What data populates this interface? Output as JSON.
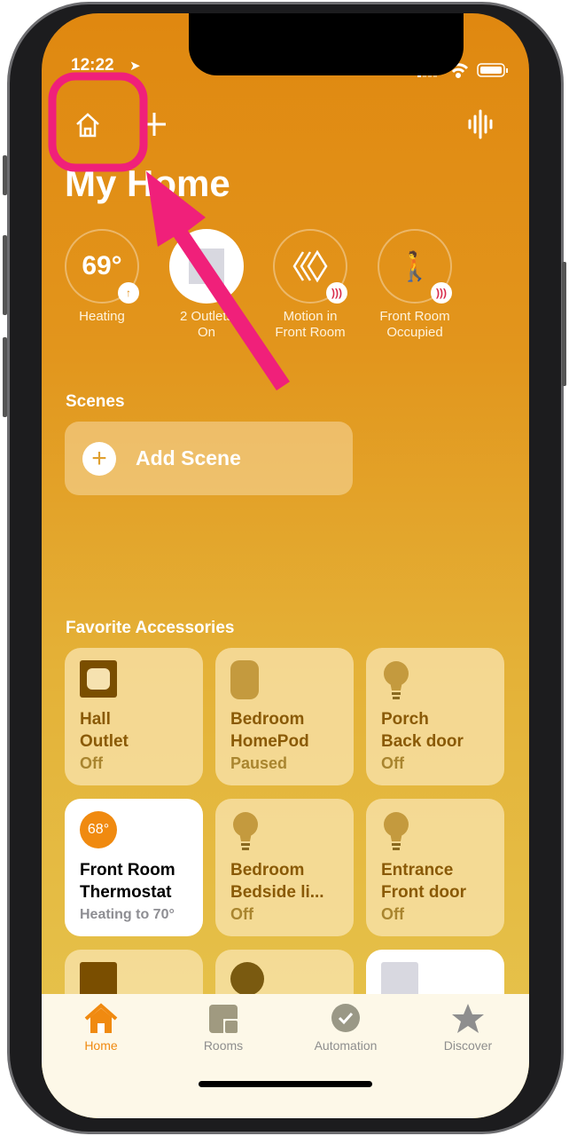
{
  "status_bar": {
    "time": "12:22"
  },
  "header": {
    "title": "My Home",
    "icons": [
      "home-icon",
      "plus-icon",
      "waveform-icon"
    ]
  },
  "status_items": [
    {
      "value": "69°",
      "line1": "Heating",
      "line2": "",
      "badge": "arrow-up"
    },
    {
      "value": "",
      "line1": "2 Outlets",
      "line2": "On",
      "badge": ""
    },
    {
      "value": "",
      "line1": "Motion in",
      "line2": "Front Room",
      "badge": "sound-waves"
    },
    {
      "value": "",
      "line1": "Front Room",
      "line2": "Occupied",
      "badge": "sound-waves"
    }
  ],
  "scenes": {
    "label": "Scenes",
    "add_label": "Add Scene"
  },
  "favorites": {
    "label": "Favorite Accessories",
    "tiles": [
      {
        "name1": "Hall",
        "name2": "Outlet",
        "status": "Off",
        "icon": "outlet-icon"
      },
      {
        "name1": "Bedroom",
        "name2": "HomePod",
        "status": "Paused",
        "icon": "homepod-icon"
      },
      {
        "name1": "Porch",
        "name2": "Back door",
        "status": "Off",
        "icon": "bulb-icon"
      },
      {
        "name1": "Front Room",
        "name2": "Thermostat",
        "status": "Heating to 70°",
        "icon": "thermostat-icon",
        "temp": "68°",
        "on": true
      },
      {
        "name1": "Bedroom",
        "name2": "Bedside li...",
        "status": "Off",
        "icon": "bulb-icon"
      },
      {
        "name1": "Entrance",
        "name2": "Front door",
        "status": "Off",
        "icon": "bulb-icon"
      }
    ]
  },
  "tabs": [
    {
      "label": "Home",
      "active": true
    },
    {
      "label": "Rooms"
    },
    {
      "label": "Automation"
    },
    {
      "label": "Discover"
    }
  ],
  "colors": {
    "accent": "#f08a10",
    "annotation": "#f0207a"
  }
}
